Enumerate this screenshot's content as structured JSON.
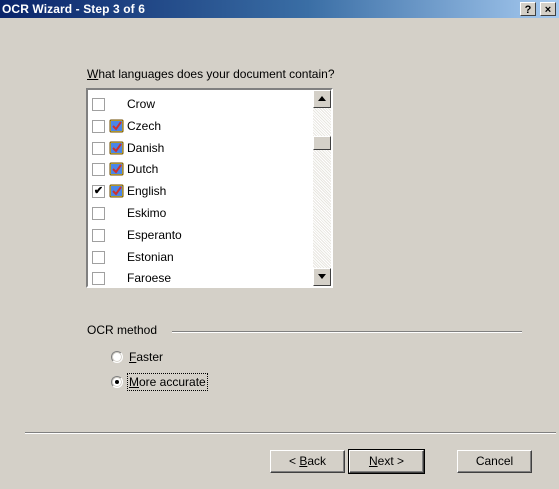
{
  "window": {
    "title": "OCR Wizard - Step 3 of 6",
    "help_glyph": "?",
    "close_glyph": "×"
  },
  "language_section": {
    "question_accel": "W",
    "question_rest": "hat languages does your document contain?",
    "items": [
      {
        "label": "Crow",
        "checked": false,
        "has_icon": false
      },
      {
        "label": "Czech",
        "checked": false,
        "has_icon": true
      },
      {
        "label": "Danish",
        "checked": false,
        "has_icon": true
      },
      {
        "label": "Dutch",
        "checked": false,
        "has_icon": true
      },
      {
        "label": "English",
        "checked": true,
        "has_icon": true
      },
      {
        "label": "Eskimo",
        "checked": false,
        "has_icon": false
      },
      {
        "label": "Esperanto",
        "checked": false,
        "has_icon": false
      },
      {
        "label": "Estonian",
        "checked": false,
        "has_icon": false
      },
      {
        "label": "Faroese",
        "checked": false,
        "has_icon": false
      }
    ],
    "check_glyph": "✔"
  },
  "ocr_method": {
    "label": "OCR method",
    "options": [
      {
        "accel": "F",
        "rest": "aster",
        "selected": false
      },
      {
        "accel": "M",
        "rest": "ore accurate",
        "selected": true
      }
    ]
  },
  "buttons": {
    "back_prefix": "< ",
    "back_accel": "B",
    "back_rest": "ack",
    "next_accel": "N",
    "next_rest": "ext >",
    "cancel": "Cancel"
  },
  "colors": {
    "title_start": "#0a246a",
    "title_end": "#a6caf0",
    "face": "#d4d0c8"
  }
}
